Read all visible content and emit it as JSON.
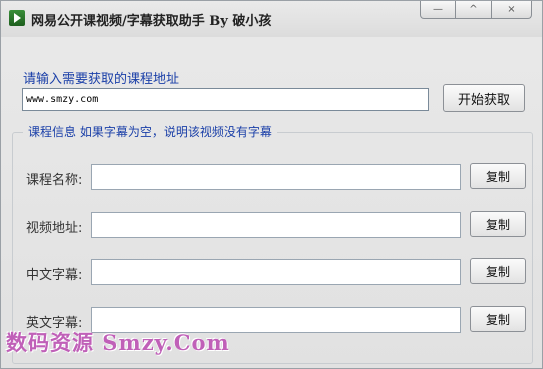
{
  "window": {
    "title": "网易公开课视频/字幕获取助手 By 破小孩",
    "controls": [
      "—",
      "^",
      "×"
    ]
  },
  "url_section": {
    "prompt": "请输入需要获取的课程地址",
    "url_value": "www.smzy.com",
    "start_button": "开始获取"
  },
  "info_group": {
    "legend": "课程信息 如果字幕为空，说明该视频没有字幕",
    "rows": [
      {
        "label": "课程名称:",
        "value": "",
        "button": "复制"
      },
      {
        "label": "视频地址:",
        "value": "",
        "button": "复制"
      },
      {
        "label": "中文字幕:",
        "value": "",
        "button": "复制"
      },
      {
        "label": "英文字幕:",
        "value": "",
        "button": "复制"
      }
    ]
  },
  "watermark": "数码资源 Smzy.Com"
}
